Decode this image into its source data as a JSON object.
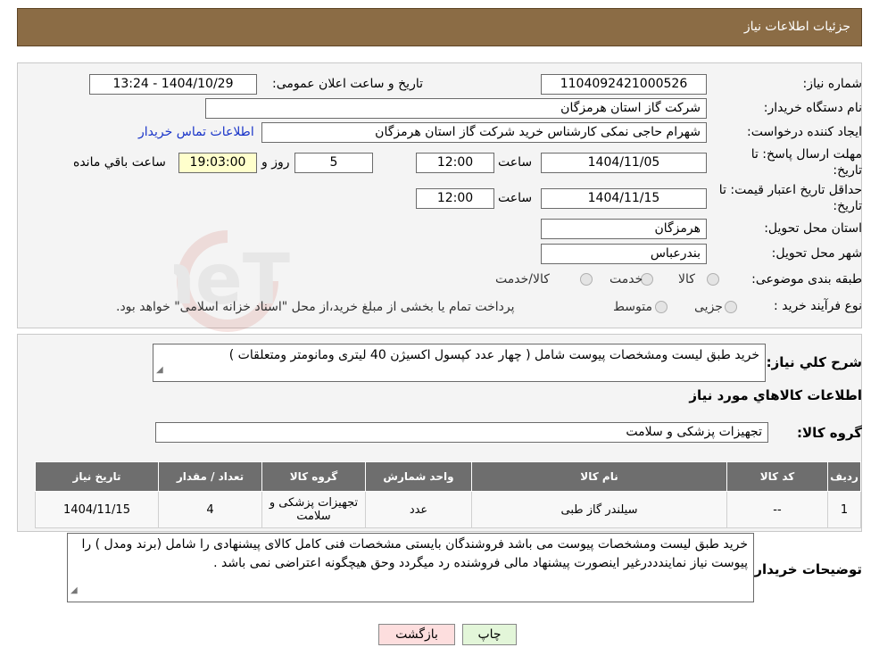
{
  "header": {
    "title": "جزئیات اطلاعات نیاز"
  },
  "form": {
    "need_number_label": "شماره نیاز:",
    "need_number": "1104092421000526",
    "announce_label": "تاریخ و ساعت اعلان عمومی:",
    "announce_value": "1404/10/29 - 13:24",
    "buyer_org_label": "نام دستگاه خریدار:",
    "buyer_org": "شرکت گاز استان هرمزگان",
    "creator_label": "ایجاد کننده درخواست:",
    "creator": "شهرام حاجی نمکی کارشناس خرید شرکت گاز استان هرمزگان",
    "contact_link": "اطلاعات تماس خریدار",
    "deadline_label_1": "مهلت ارسال پاسخ: تا",
    "deadline_label_2": "تاریخ:",
    "deadline_date": "1404/11/05",
    "time_label": "ساعت",
    "deadline_time": "12:00",
    "days_value": "5",
    "days_label": "روز و",
    "remaining_time": "19:03:00",
    "remaining_label": "ساعت باقي مانده",
    "validity_label_1": "حداقل تاریخ اعتبار قیمت: تا",
    "validity_label_2": "تاریخ:",
    "validity_date": "1404/11/15",
    "validity_time": "12:00",
    "province_label": "استان محل تحویل:",
    "province": "هرمزگان",
    "city_label": "شهر محل تحویل:",
    "city": "بندرعباس",
    "category_label": "طبقه بندی موضوعی:",
    "category_options": [
      "کالا",
      "خدمت",
      "کالا/خدمت"
    ],
    "process_label": "نوع فرآیند خرید :",
    "process_options": [
      "جزیی",
      "متوسط"
    ],
    "process_note": "پرداخت تمام یا بخشی از مبلغ خرید،از محل \"اسناد خزانه اسلامی\" خواهد بود."
  },
  "summary": {
    "label": "شرح کلي نیاز:",
    "text": "خرید طبق لیست ومشخصات پیوست شامل ( چهار عدد کپسول اکسیژن 40 لیتری ومانومتر ومتعلقات )",
    "goods_title": "اطلاعات کالاهاي مورد نیاز",
    "group_label": "گروه کالا:",
    "group_value": "تجهیزات پزشکی و سلامت"
  },
  "table": {
    "headers": [
      "ردیف",
      "کد کالا",
      "نام کالا",
      "واحد شمارش",
      "گروه کالا",
      "تعداد / مقدار",
      "تاریخ نیاز"
    ],
    "rows": [
      [
        "1",
        "--",
        "سیلندر گاز طبی",
        "عدد",
        "تجهیزات پزشکی و سلامت",
        "4",
        "1404/11/15"
      ]
    ]
  },
  "buyer_notes": {
    "label": "توضیحات خریدار:",
    "text": "خرید طبق لیست ومشخصات پیوست می باشد فروشندگان بایستی مشخصات فنی کامل کالای پیشنهادی را شامل (برند ومدل ) را پیوست نیاز نمایندددرغیر اینصورت پیشنهاد مالی فروشنده رد میگردد وحق هیچگونه اعتراضی نمی باشد ."
  },
  "buttons": {
    "print": "چاپ",
    "back": "بازگشت"
  },
  "watermark": {
    "text": "AriaTender.neT"
  },
  "colors": {
    "header_bg": "#8b6c45",
    "table_header_bg": "#6e6e6e",
    "link": "#1a35c9",
    "back_button_bg": "#fddede",
    "print_button_bg": "#e3f6d9"
  }
}
